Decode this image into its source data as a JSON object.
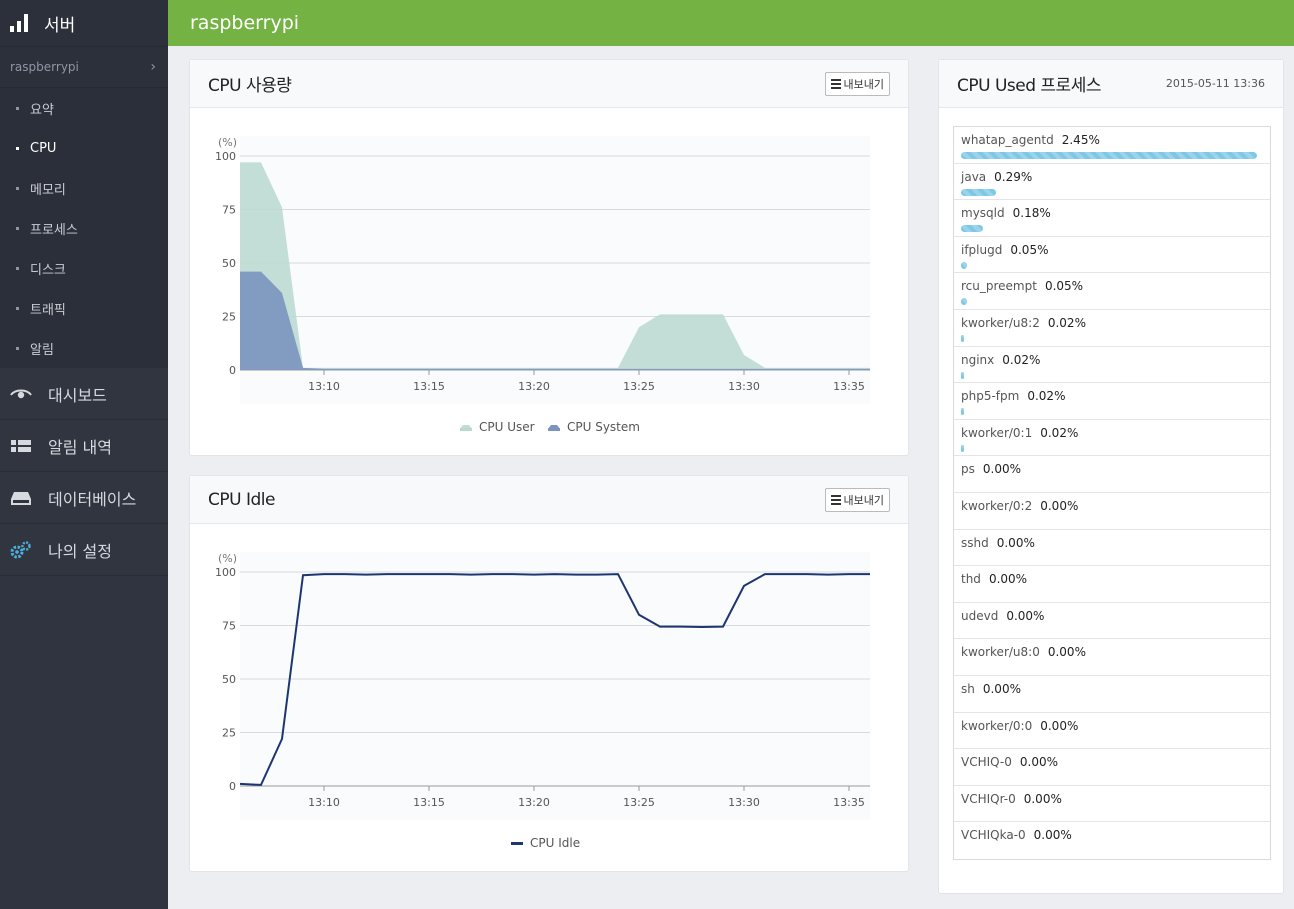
{
  "sidebar": {
    "title": "서버",
    "host": "raspberrypi",
    "sub_items": [
      {
        "label": "요약"
      },
      {
        "label": "CPU"
      },
      {
        "label": "메모리"
      },
      {
        "label": "프로세스"
      },
      {
        "label": "디스크"
      },
      {
        "label": "트래픽"
      },
      {
        "label": "알림"
      }
    ],
    "active_sub": "CPU",
    "main_items": [
      {
        "label": "대시보드",
        "icon": "eye-icon"
      },
      {
        "label": "알림 내역",
        "icon": "list-icon"
      },
      {
        "label": "데이터베이스",
        "icon": "database-icon"
      },
      {
        "label": "나의 설정",
        "icon": "gear-icon"
      }
    ]
  },
  "topbar": {
    "title": "raspberrypi"
  },
  "cpu_usage": {
    "title": "CPU 사용량",
    "export_label": "내보내기"
  },
  "cpu_idle": {
    "title": "CPU Idle",
    "export_label": "내보내기"
  },
  "processes": {
    "title": "CPU Used 프로세스",
    "timestamp": "2015-05-11 13:36",
    "items": [
      {
        "name": "whatap_agentd",
        "value": "2.45%",
        "pct": 2.45
      },
      {
        "name": "java",
        "value": "0.29%",
        "pct": 0.29
      },
      {
        "name": "mysqld",
        "value": "0.18%",
        "pct": 0.18
      },
      {
        "name": "ifplugd",
        "value": "0.05%",
        "pct": 0.05
      },
      {
        "name": "rcu_preempt",
        "value": "0.05%",
        "pct": 0.05
      },
      {
        "name": "kworker/u8:2",
        "value": "0.02%",
        "pct": 0.02
      },
      {
        "name": "nginx",
        "value": "0.02%",
        "pct": 0.02
      },
      {
        "name": "php5-fpm",
        "value": "0.02%",
        "pct": 0.02
      },
      {
        "name": "kworker/0:1",
        "value": "0.02%",
        "pct": 0.02
      },
      {
        "name": "ps",
        "value": "0.00%",
        "pct": 0
      },
      {
        "name": "kworker/0:2",
        "value": "0.00%",
        "pct": 0
      },
      {
        "name": "sshd",
        "value": "0.00%",
        "pct": 0
      },
      {
        "name": "thd",
        "value": "0.00%",
        "pct": 0
      },
      {
        "name": "udevd",
        "value": "0.00%",
        "pct": 0
      },
      {
        "name": "kworker/u8:0",
        "value": "0.00%",
        "pct": 0
      },
      {
        "name": "sh",
        "value": "0.00%",
        "pct": 0
      },
      {
        "name": "kworker/0:0",
        "value": "0.00%",
        "pct": 0
      },
      {
        "name": "VCHIQ-0",
        "value": "0.00%",
        "pct": 0
      },
      {
        "name": "VCHIQr-0",
        "value": "0.00%",
        "pct": 0
      },
      {
        "name": "VCHIQka-0",
        "value": "0.00%",
        "pct": 0
      }
    ]
  },
  "colors": {
    "topbar": "#74b343",
    "cpu_user": "#b9d8d0",
    "cpu_system": "#7b93bf",
    "cpu_idle": "#1d3672",
    "bar": "#7ec7e6"
  },
  "chart_data": [
    {
      "type": "area",
      "title": "CPU 사용량",
      "ylabel": "(%)",
      "ylim": [
        0,
        100
      ],
      "yticks": [
        0,
        25,
        50,
        75,
        100
      ],
      "xlim": [
        "13:06",
        "13:36"
      ],
      "xticks": [
        "13:10",
        "13:15",
        "13:20",
        "13:25",
        "13:30",
        "13:35"
      ],
      "legend": "bottom",
      "grid": true,
      "x": [
        "13:06",
        "13:07",
        "13:08",
        "13:09",
        "13:10",
        "13:11",
        "13:12",
        "13:13",
        "13:14",
        "13:15",
        "13:16",
        "13:17",
        "13:18",
        "13:19",
        "13:20",
        "13:21",
        "13:22",
        "13:23",
        "13:24",
        "13:25",
        "13:26",
        "13:27",
        "13:28",
        "13:29",
        "13:30",
        "13:31",
        "13:32",
        "13:33",
        "13:34",
        "13:35",
        "13:36"
      ],
      "series": [
        {
          "name": "CPU User",
          "values": [
            97,
            97,
            76,
            1,
            1,
            1,
            1,
            1,
            1,
            1,
            1,
            1,
            1,
            1,
            1,
            1,
            1,
            1,
            1,
            20,
            26,
            26,
            26,
            26,
            7,
            1,
            1,
            1,
            1,
            1,
            1
          ]
        },
        {
          "name": "CPU System",
          "values": [
            46,
            46,
            36,
            1,
            0.5,
            0.5,
            0.5,
            0.5,
            0.5,
            0.5,
            0.5,
            0.5,
            0.5,
            0.5,
            0.5,
            0.5,
            0.5,
            0.5,
            0.5,
            0.5,
            0.5,
            0.5,
            0.5,
            0.5,
            0.5,
            0.5,
            0.5,
            0.5,
            0.5,
            0.5,
            0.5
          ]
        }
      ]
    },
    {
      "type": "line",
      "title": "CPU Idle",
      "ylabel": "(%)",
      "ylim": [
        0,
        100
      ],
      "yticks": [
        0,
        25,
        50,
        75,
        100
      ],
      "xlim": [
        "13:06",
        "13:36"
      ],
      "xticks": [
        "13:10",
        "13:15",
        "13:20",
        "13:25",
        "13:30",
        "13:35"
      ],
      "legend": "bottom",
      "grid": true,
      "x": [
        "13:06",
        "13:07",
        "13:08",
        "13:09",
        "13:10",
        "13:11",
        "13:12",
        "13:13",
        "13:14",
        "13:15",
        "13:16",
        "13:17",
        "13:18",
        "13:19",
        "13:20",
        "13:21",
        "13:22",
        "13:23",
        "13:24",
        "13:25",
        "13:26",
        "13:27",
        "13:28",
        "13:29",
        "13:30",
        "13:31",
        "13:32",
        "13:33",
        "13:34",
        "13:35",
        "13:36"
      ],
      "series": [
        {
          "name": "CPU Idle",
          "values": [
            1,
            0.5,
            22,
            98.5,
            99,
            99,
            98.8,
            99,
            99,
            99,
            99,
            98.8,
            99,
            99,
            98.8,
            99,
            98.8,
            98.8,
            99,
            80,
            74.5,
            74.5,
            74.3,
            74.5,
            93.5,
            99,
            99,
            99,
            98.8,
            99,
            99
          ]
        }
      ]
    }
  ]
}
